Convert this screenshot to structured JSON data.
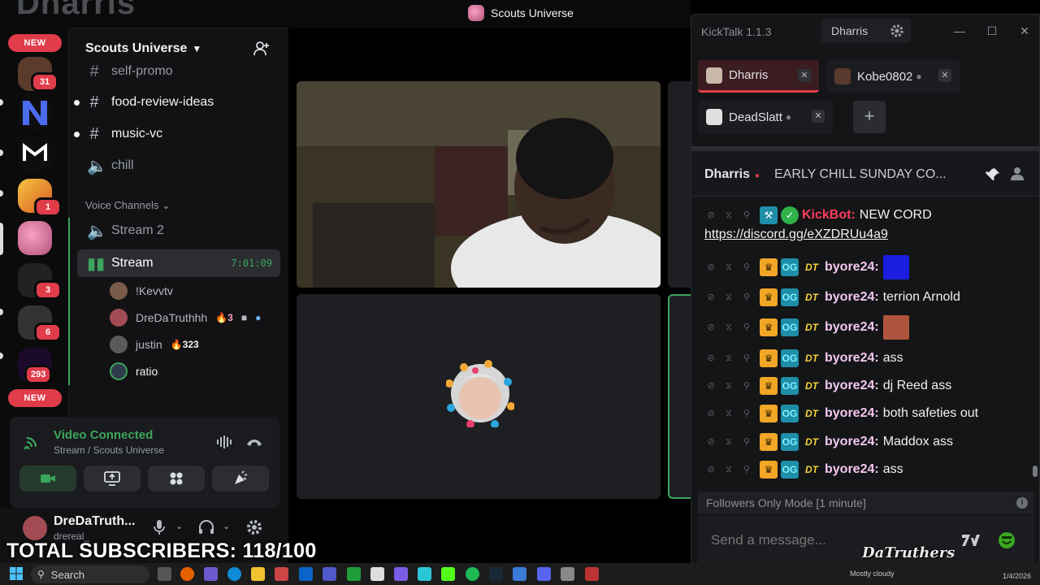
{
  "discord": {
    "window_title": "Scouts Universe",
    "server_name": "Scouts Universe",
    "rail": {
      "new_label": "NEW",
      "badges": [
        "31",
        "1",
        "3",
        "6",
        "293"
      ]
    },
    "channels": [
      {
        "name": "self-promo",
        "type": "text"
      },
      {
        "name": "food-review-ideas",
        "type": "text"
      },
      {
        "name": "music-vc",
        "type": "text"
      },
      {
        "name": "chill",
        "type": "voice"
      }
    ],
    "voice_category": "Voice Channels",
    "voice_channels": [
      {
        "name": "Stream 2"
      },
      {
        "name": "Stream",
        "timer": "7:01:09"
      }
    ],
    "voice_users": [
      {
        "name": "!Kevvtv"
      },
      {
        "name": "DreDaTruthhh",
        "streak": "3"
      },
      {
        "name": "justin",
        "streak": "323"
      },
      {
        "name": "ratio"
      }
    ],
    "voice_panel": {
      "status": "Video Connected",
      "location": "Stream / Scouts Universe"
    },
    "user": {
      "display_name": "DreDaTruth...",
      "username": "drereal_"
    }
  },
  "overlay": {
    "subscribers": "TOTAL SUBSCRIBERS: 118/100"
  },
  "kicktalk": {
    "app_title": "KickTalk 1.1.3",
    "current_user": "Dharris",
    "tabs": [
      {
        "name": "Dharris",
        "active": true
      },
      {
        "name": "Kobe0802",
        "active": false
      },
      {
        "name": "DeadSlatt",
        "active": false
      }
    ],
    "stream": {
      "streamer": "Dharris",
      "title": "EARLY CHILL SUNDAY CO..."
    },
    "messages": [
      {
        "user": "KickBot:",
        "text": "NEW CORD",
        "bot": true
      },
      {
        "user": "byore24:",
        "text": "",
        "emote": "blue"
      },
      {
        "user": "byore24:",
        "text": "terrion Arnold"
      },
      {
        "user": "byore24:",
        "text": "",
        "emote": "face"
      },
      {
        "user": "byore24:",
        "text": "ass"
      },
      {
        "user": "byore24:",
        "text": "dj Reed ass"
      },
      {
        "user": "byore24:",
        "text": "both safeties out"
      },
      {
        "user": "byore24:",
        "text": "Maddox ass"
      },
      {
        "user": "byore24:",
        "text": "ass"
      }
    ],
    "link": "https://discord.gg/eXZDRUu4a9",
    "mode_notice": "Followers Only Mode [1 minute]",
    "input_placeholder": "Send a message...",
    "watermark": "DaTruthers",
    "colors": {
      "accent": "#e03c4a",
      "kick_green": "#53fc18"
    }
  },
  "taskbar": {
    "search_label": "Search",
    "weather": "Mostly cloudy",
    "date": "1/4/2026"
  }
}
